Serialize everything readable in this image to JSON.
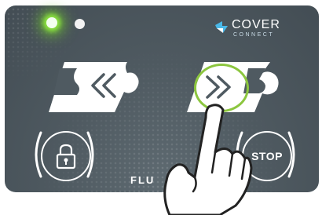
{
  "logo": {
    "main": "COVER",
    "sub": "CONNECT"
  },
  "buttons": {
    "close": {
      "icon": "chevrons-left-icon"
    },
    "open": {
      "icon": "chevrons-right-icon",
      "highlight_color": "#8cc63f"
    },
    "lock": {
      "icon": "lock-icon"
    },
    "stop": {
      "label": "STOP"
    }
  },
  "indicators": {
    "led_active_color": "#8ee640",
    "led_idle_color": "#f2f2f2"
  },
  "brand_bottom": "FLU",
  "colors": {
    "panel": "#4f5a61",
    "accent": "#8cc63f",
    "logo_accent": "#4ab8e8"
  }
}
